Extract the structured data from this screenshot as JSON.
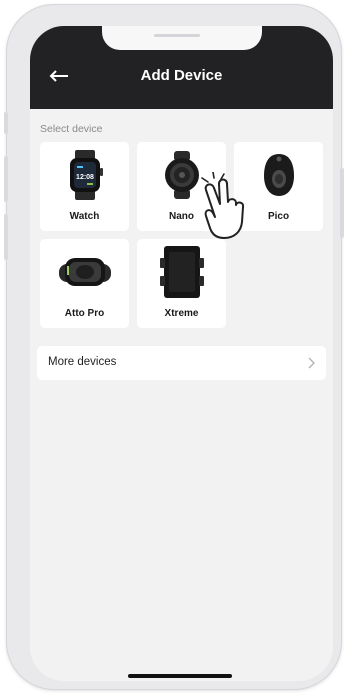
{
  "header": {
    "title": "Add Device",
    "back_icon": "arrow-left-icon"
  },
  "section_label": "Select device",
  "devices": [
    {
      "label": "Watch",
      "icon": "smartwatch-icon",
      "screen_time": "12:08"
    },
    {
      "label": "Nano",
      "icon": "nano-tracker-icon"
    },
    {
      "label": "Pico",
      "icon": "pico-tag-icon"
    },
    {
      "label": "Atto Pro",
      "icon": "atto-pro-icon"
    },
    {
      "label": "Xtreme",
      "icon": "xtreme-device-icon"
    }
  ],
  "more_devices": {
    "label": "More devices",
    "icon": "chevron-right-icon"
  },
  "colors": {
    "header_bg": "#222224",
    "screen_bg": "#f2f2f2",
    "tile_bg": "#ffffff"
  }
}
